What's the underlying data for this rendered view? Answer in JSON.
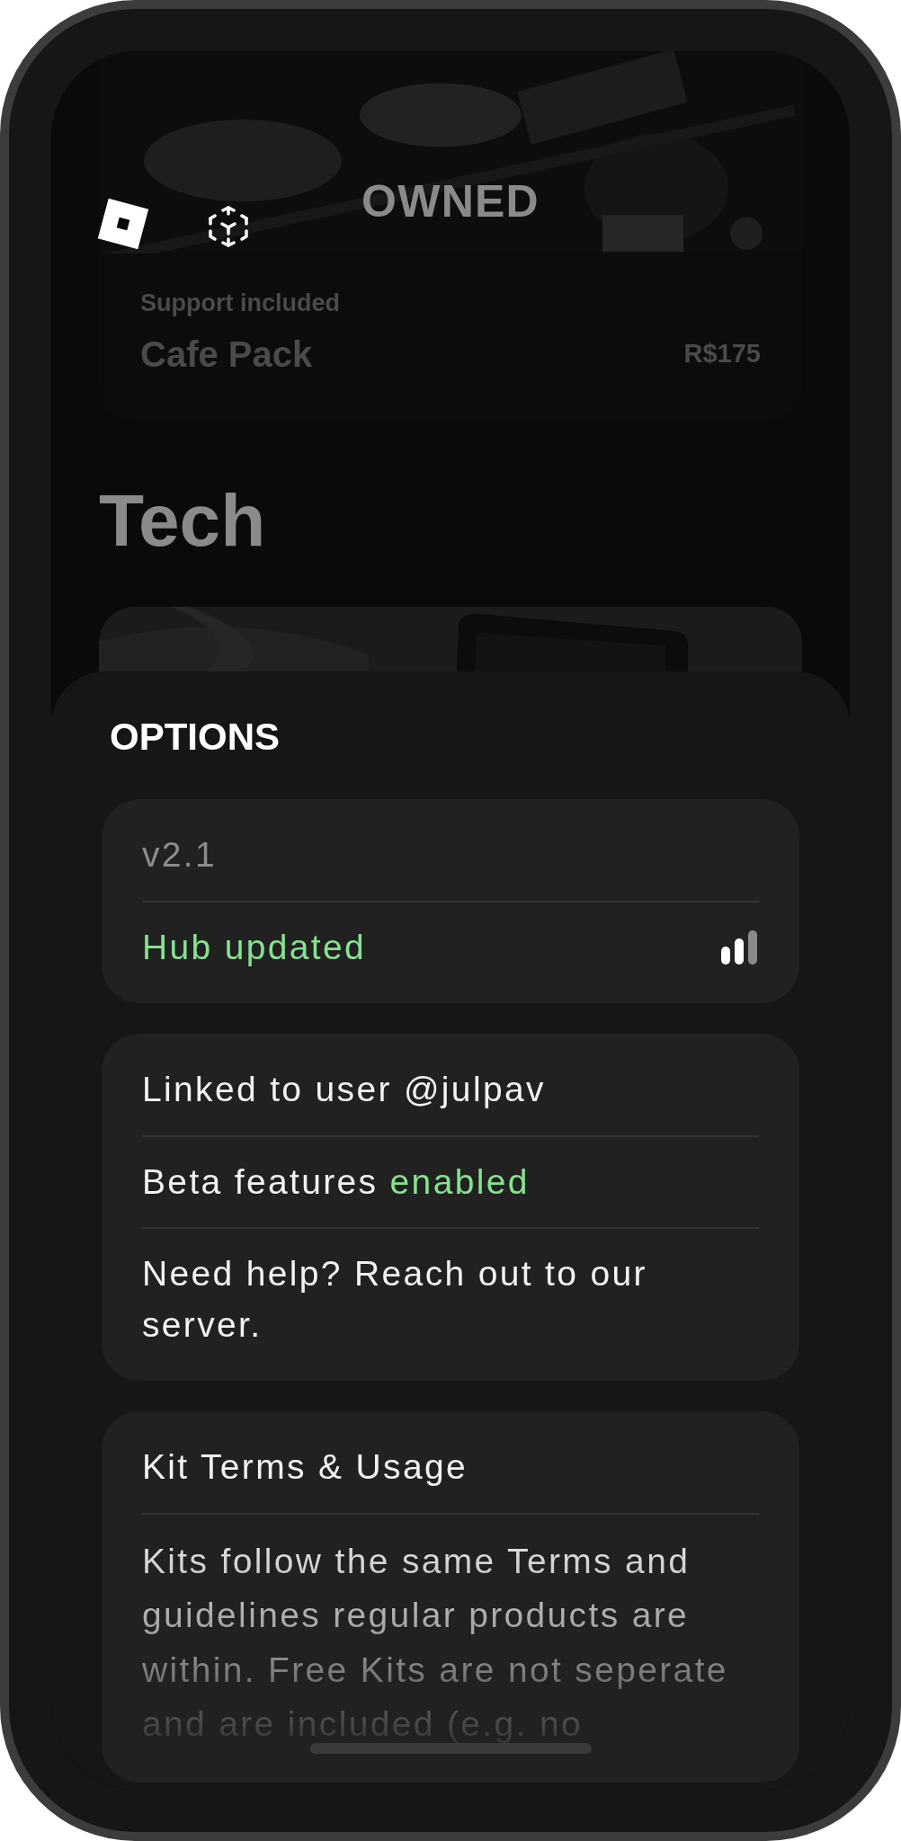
{
  "header": {
    "title": "OWNED"
  },
  "featured": {
    "subtitle": "Support included",
    "name": "Cafe Pack",
    "price": "R$175"
  },
  "section": {
    "title": "Tech"
  },
  "sheet": {
    "title": "OPTIONS",
    "cards": [
      {
        "rows": [
          {
            "kind": "version",
            "text": "v2.1"
          },
          {
            "kind": "status",
            "text": "Hub updated"
          }
        ]
      },
      {
        "rows": [
          {
            "kind": "plain",
            "text": "Linked to user @julpav"
          },
          {
            "kind": "highlight",
            "text": "Beta features",
            "highlight": "enabled"
          },
          {
            "kind": "plain",
            "text": "Need help? Reach out to our server."
          }
        ]
      },
      {
        "rows": [
          {
            "kind": "plain",
            "text": "Kit Terms & Usage"
          },
          {
            "kind": "faded",
            "text": "Kits follow the same Terms and guidelines regular products are within. Free Kits are not seperate and are included (e.g. no"
          }
        ]
      }
    ]
  }
}
